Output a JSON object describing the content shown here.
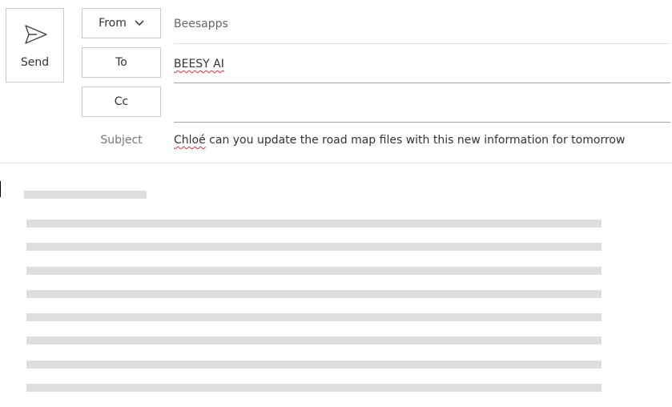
{
  "toolbar": {
    "send_label": "Send",
    "send_icon": "paper-plane-icon"
  },
  "fields": {
    "from_label": "From",
    "from_value": "Beesapps",
    "to_label": "To",
    "to_value": "BEESY AI",
    "cc_label": "Cc",
    "cc_value": "",
    "subject_label": "Subject",
    "subject_first_word": "Chloé",
    "subject_rest": " can you update the road map files with this new information for tomorrow"
  },
  "colors": {
    "border": "#c8c8c8",
    "skeleton": "#dedede",
    "spellcheck": "#d13438"
  }
}
